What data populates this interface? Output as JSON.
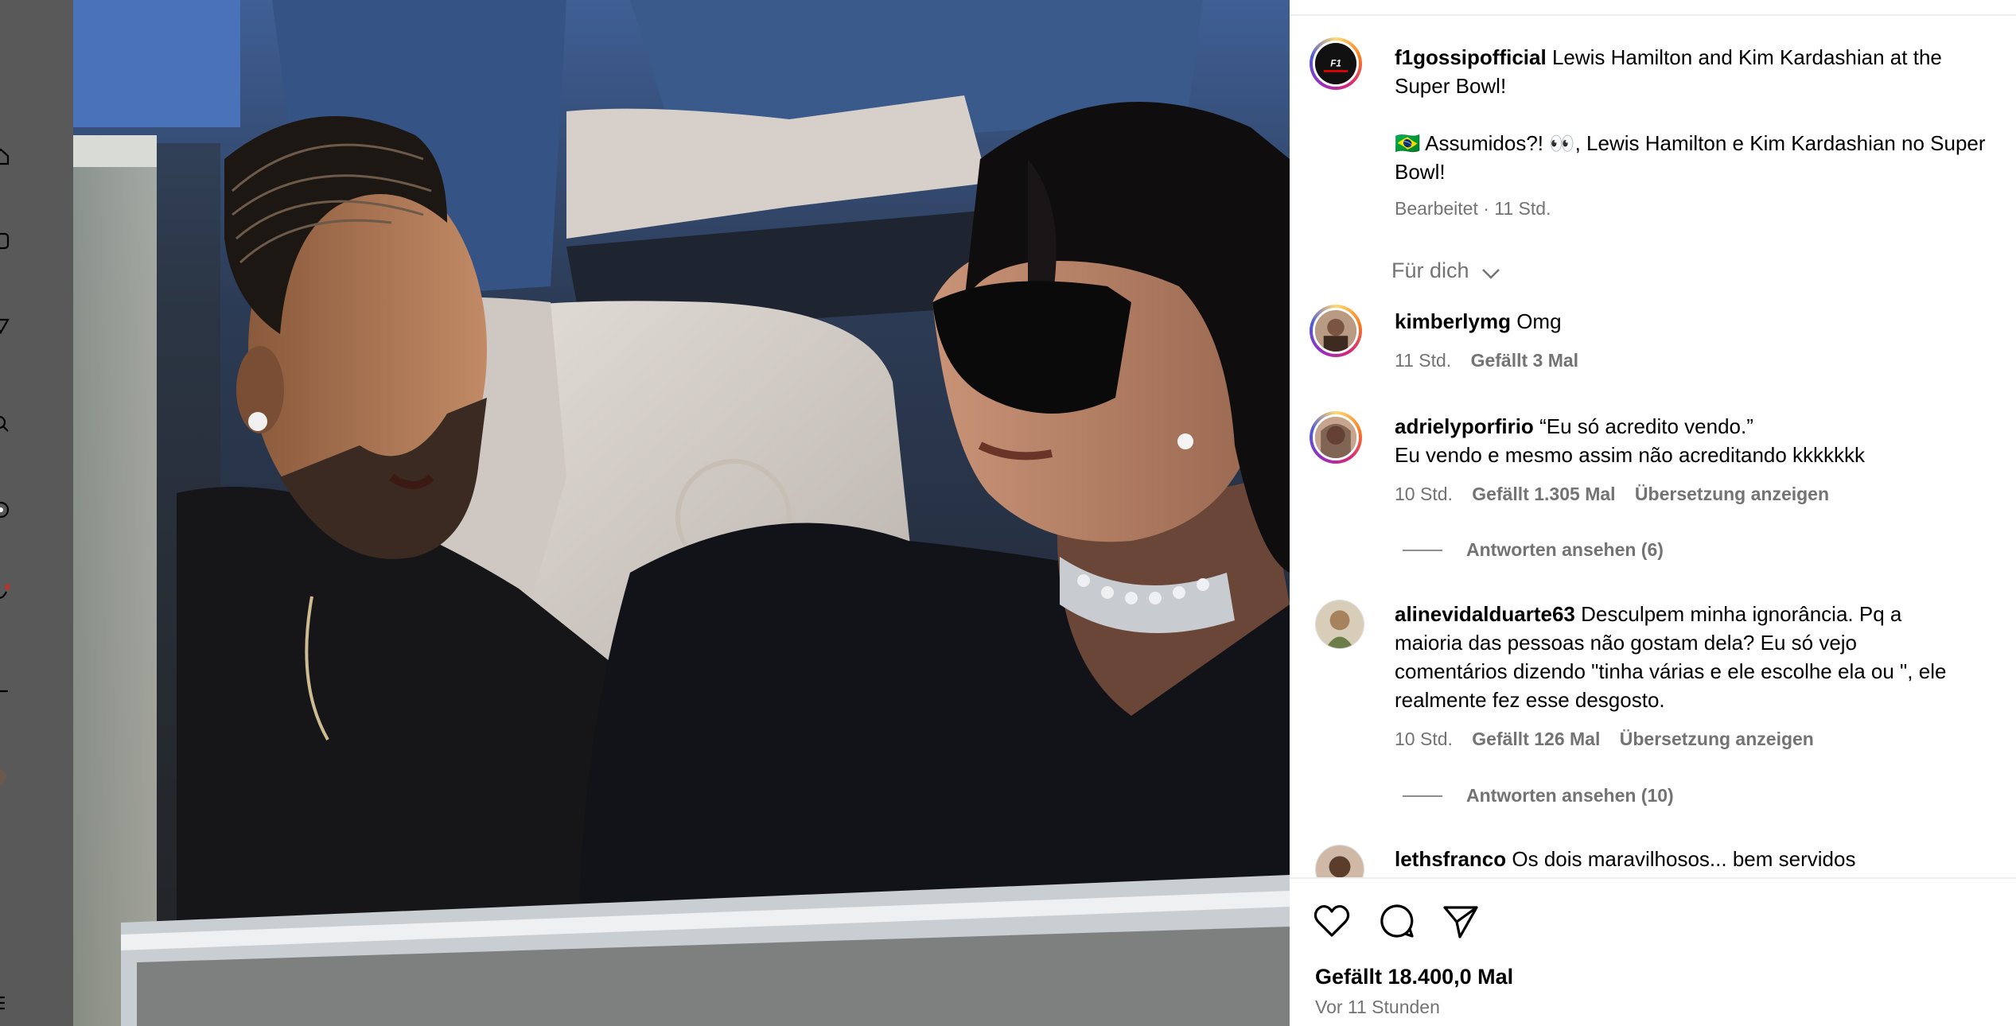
{
  "post": {
    "username": "f1gossipofficial",
    "caption_line1": "Lewis Hamilton and Kim Kardashian at the",
    "caption_line2": "Super Bowl!",
    "caption_line3": "🇧🇷 Assumidos?! 👀, Lewis Hamilton e Kim Kardashian no Super",
    "caption_line4": "Bowl!",
    "meta": "Bearbeitet · 11 Std.",
    "sort_label": "Für dich"
  },
  "comments": [
    {
      "username": "kimberlymg",
      "text_line1": "Omg",
      "time": "11 Std.",
      "likes": "Gefällt 3 Mal"
    },
    {
      "username": "adrielyporfirio",
      "text_line1": "“Eu só acredito vendo.”",
      "text_line2": "Eu vendo e mesmo assim não acreditando kkkkkkk",
      "time": "10 Std.",
      "likes": "Gefällt 1.305 Mal",
      "translate": "Übersetzung anzeigen",
      "replies": "Antworten ansehen (6)"
    },
    {
      "username": "alinevidalduarte63",
      "text_line1": "Desculpem minha ignorância. Pq a",
      "text_line2": "maioria das pessoas não gostam dela? Eu só vejo",
      "text_line3": "comentários dizendo \"tinha várias e ele escolhe ela ou \", ele",
      "text_line4": "realmente fez esse desgosto.",
      "time": "10 Std.",
      "likes": "Gefällt 126 Mal",
      "translate": "Übersetzung anzeigen",
      "replies": "Antworten ansehen (10)"
    },
    {
      "username": "lethsfranco",
      "text_line1": "Os dois maravilhosos... bem servidos"
    }
  ],
  "footer": {
    "likes": "Gefällt 18.400,0 Mal",
    "time_ago": "Vor 11 Stunden"
  },
  "icons": [
    "home-icon",
    "reels-icon",
    "send-icon",
    "search-icon",
    "explore-icon",
    "notification-icon",
    "create-icon",
    "heart-icon",
    "comment-icon",
    "share-icon",
    "chevron-down-icon"
  ],
  "colors": {
    "nav_strip": "#595959",
    "secondary_text": "#737373",
    "divider": "#efefef",
    "notification_dot": "#b1362f"
  }
}
